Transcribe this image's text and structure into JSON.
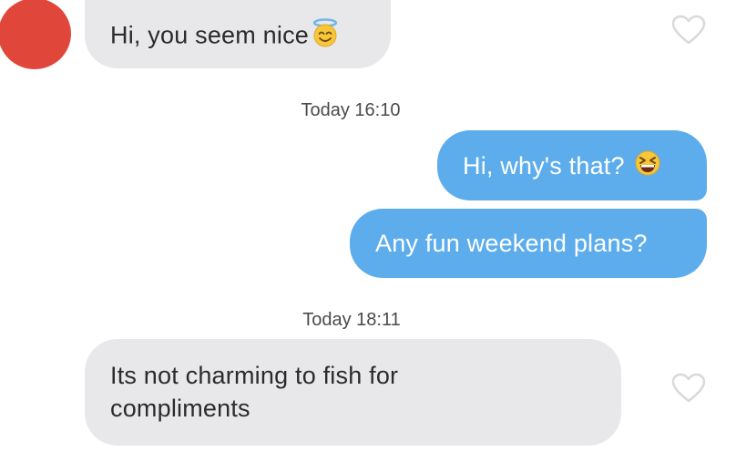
{
  "contact": {
    "avatar_color": "#e1463a"
  },
  "messages": [
    {
      "from": "them",
      "text": "Hi, you seem nice",
      "emoji": "smiling-face-with-halo"
    },
    {
      "timestamp": "Today 16:10"
    },
    {
      "from": "me",
      "text": "Hi, why's that?",
      "emoji": "grinning-squinting-face"
    },
    {
      "from": "me",
      "text": "Any fun weekend plans?"
    },
    {
      "timestamp": "Today 18:11"
    },
    {
      "from": "them",
      "text": "Its not charming to fish for compliments"
    }
  ],
  "colors": {
    "received_bubble": "#e8e8ea",
    "sent_bubble": "#5dadec",
    "heart_outline": "#d9d9d9"
  },
  "icons": {
    "like": "heart-outline-icon"
  }
}
